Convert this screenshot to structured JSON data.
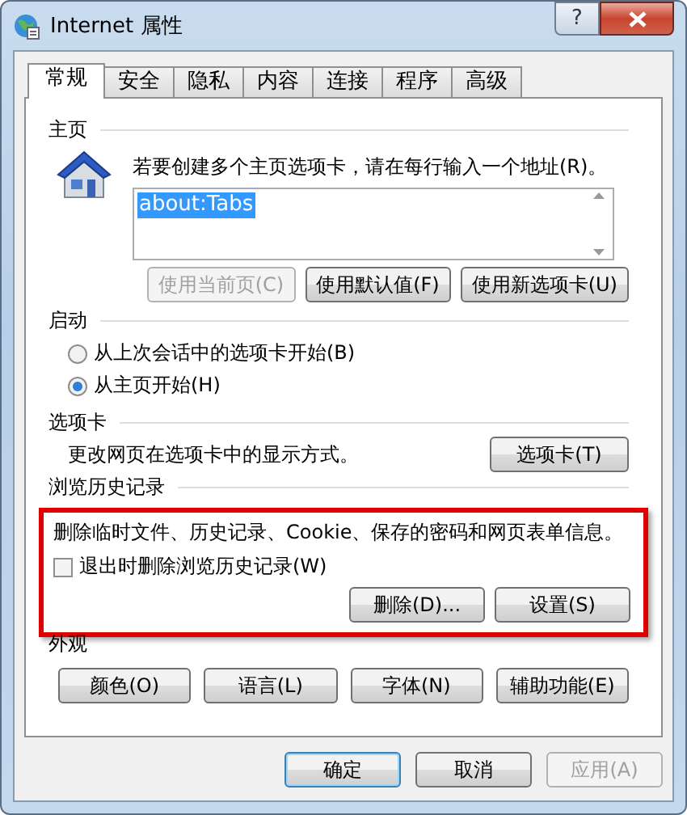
{
  "window": {
    "title": "Internet 属性",
    "help_button": "?"
  },
  "tabs": [
    {
      "label": "常规",
      "selected": true
    },
    {
      "label": "安全",
      "selected": false
    },
    {
      "label": "隐私",
      "selected": false
    },
    {
      "label": "内容",
      "selected": false
    },
    {
      "label": "连接",
      "selected": false
    },
    {
      "label": "程序",
      "selected": false
    },
    {
      "label": "高级",
      "selected": false
    }
  ],
  "home_page": {
    "heading": "主页",
    "description": "若要创建多个主页选项卡，请在每行输入一个地址(R)。",
    "address": {
      "value": "about:Tabs",
      "selected": true
    },
    "buttons": [
      {
        "label": "使用当前页(C)",
        "disabled": true
      },
      {
        "label": "使用默认值(F)",
        "disabled": false
      },
      {
        "label": "使用新选项卡(U)",
        "disabled": false
      }
    ]
  },
  "startup": {
    "heading": "启动",
    "options": [
      {
        "label": "从上次会话中的选项卡开始(B)",
        "selected": false
      },
      {
        "label": "从主页开始(H)",
        "selected": true
      }
    ]
  },
  "tabs_section": {
    "heading": "选项卡",
    "description": "更改网页在选项卡中的显示方式。",
    "button": "选项卡(T)"
  },
  "history": {
    "heading": "浏览历史记录",
    "highlighted": true,
    "description": "删除临时文件、历史记录、Cookie、保存的密码和网页表单信息。",
    "checkbox": {
      "label": "退出时删除浏览历史记录(W)",
      "checked": false
    },
    "buttons": [
      {
        "label": "删除(D)..."
      },
      {
        "label": "设置(S)"
      }
    ]
  },
  "appearance": {
    "heading": "外观",
    "buttons": [
      {
        "label": "颜色(O)"
      },
      {
        "label": "语言(L)"
      },
      {
        "label": "字体(N)"
      },
      {
        "label": "辅助功能(E)"
      }
    ]
  },
  "footer_buttons": [
    {
      "label": "确定",
      "default": true,
      "disabled": false
    },
    {
      "label": "取消",
      "default": false,
      "disabled": false
    },
    {
      "label": "应用(A)",
      "default": false,
      "disabled": true
    }
  ]
}
